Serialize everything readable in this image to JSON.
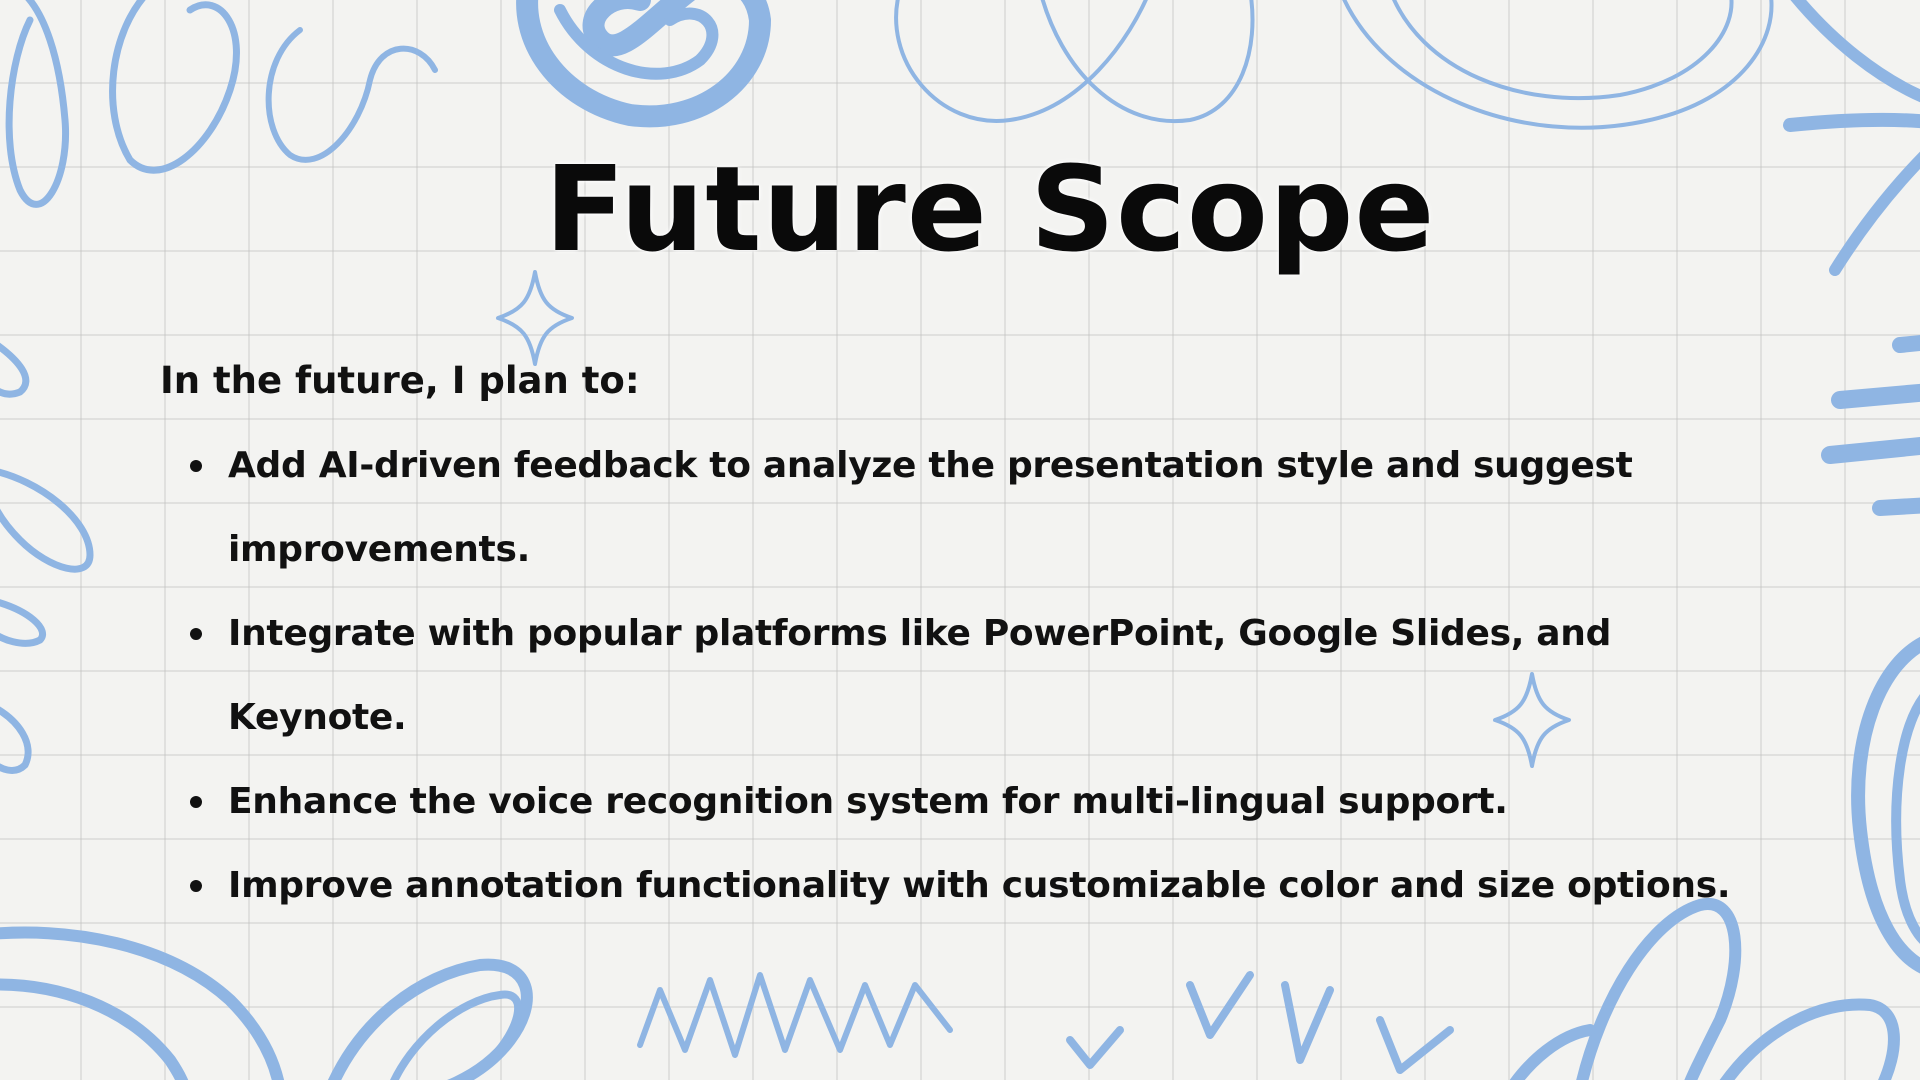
{
  "slide": {
    "title": "Future Scope",
    "intro": "In the future, I plan to:",
    "bullets": [
      "Add AI-driven feedback to analyze the presentation style and suggest improvements.",
      "Integrate with popular platforms like PowerPoint, Google Slides, and Keynote.",
      "Enhance the voice recognition system for multi-lingual support.",
      "Improve annotation functionality with customizable color and size options."
    ]
  },
  "colors": {
    "background": "#f3f3f1",
    "grid": "#bebebc",
    "doodle": "#8fb5e3",
    "text": "#111111"
  }
}
